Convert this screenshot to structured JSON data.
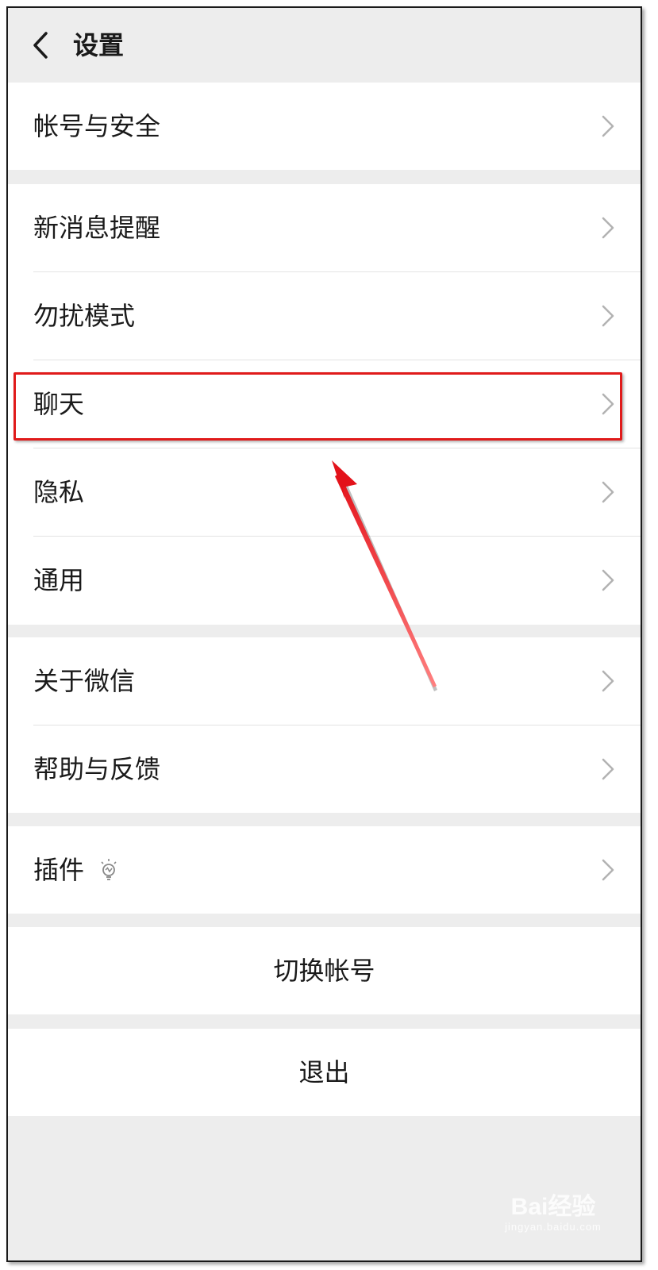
{
  "header": {
    "title": "设置"
  },
  "sections": {
    "account": {
      "items": [
        {
          "label": "帐号与安全"
        }
      ]
    },
    "main": {
      "items": [
        {
          "label": "新消息提醒"
        },
        {
          "label": "勿扰模式"
        },
        {
          "label": "聊天"
        },
        {
          "label": "隐私"
        },
        {
          "label": "通用"
        }
      ]
    },
    "about": {
      "items": [
        {
          "label": "关于微信"
        },
        {
          "label": "帮助与反馈"
        }
      ]
    },
    "plugins": {
      "items": [
        {
          "label": "插件"
        }
      ]
    }
  },
  "actions": {
    "switch_account": "切换帐号",
    "logout": "退出"
  },
  "annotation": {
    "highlighted_item": "聊天",
    "color": "#e01a1a"
  },
  "watermark": {
    "logo": "Bai经验",
    "sub": "jingyan.baidu.com"
  },
  "icons": {
    "back": "chevron-left-icon",
    "chevron": "chevron-right-icon",
    "plugin_badge": "lightbulb-icon"
  }
}
